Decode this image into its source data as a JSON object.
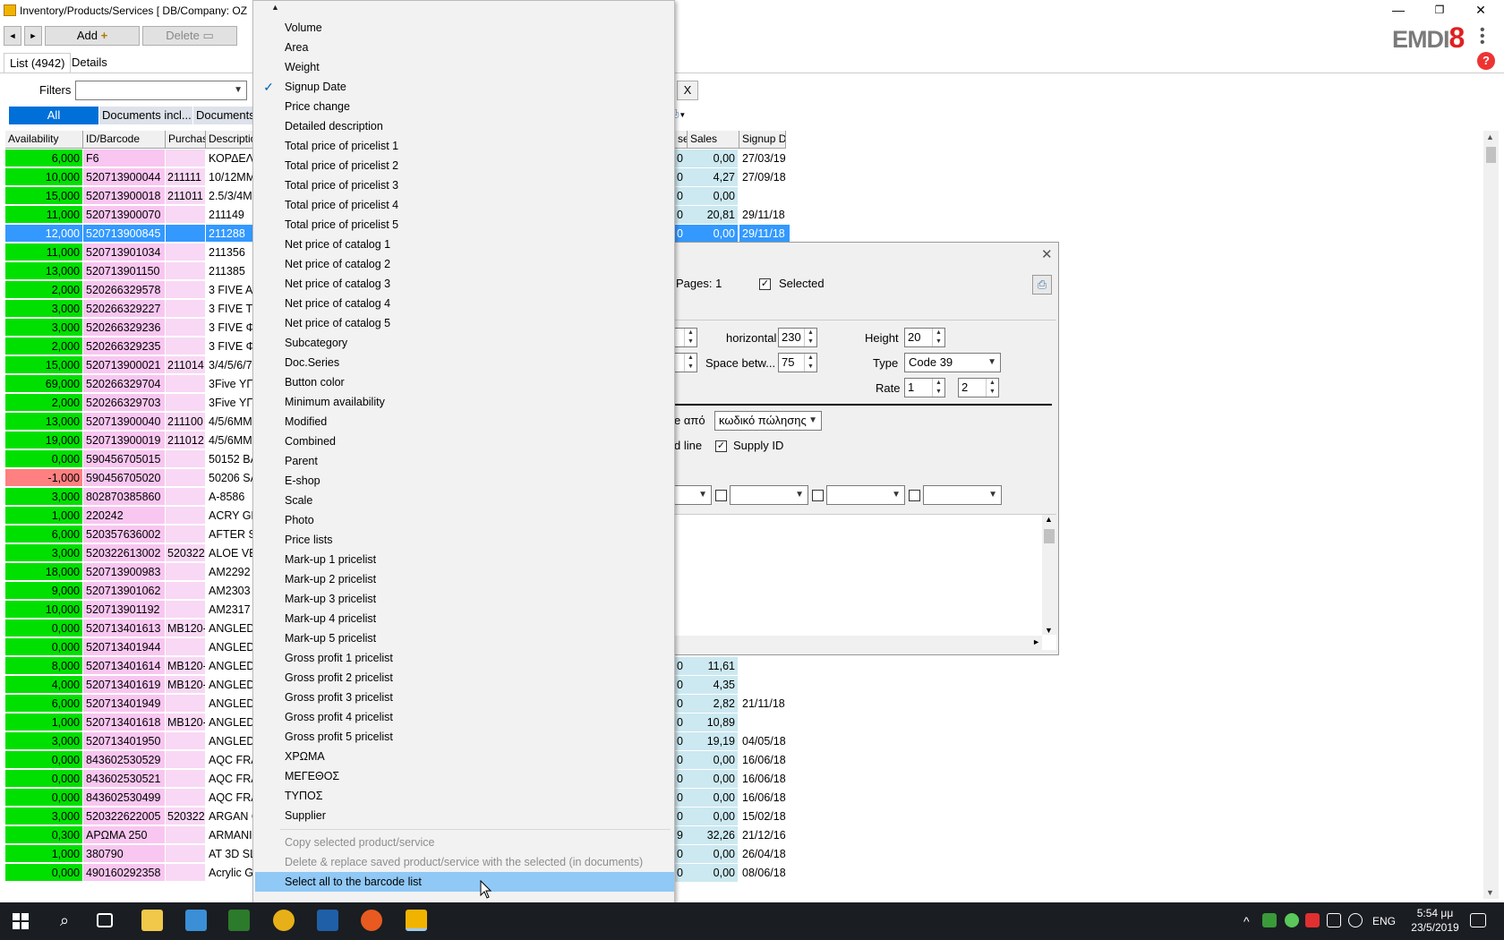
{
  "window": {
    "title": "Inventory/Products/Services  [ DB/Company: OZ",
    "minimize": "—",
    "restore": "❐",
    "close": "✕"
  },
  "toolbar": {
    "back": "◄",
    "forward": "►",
    "add_label": "Add",
    "delete_label": "Delete"
  },
  "tabs": {
    "list": "List (4942)",
    "details": "Details"
  },
  "filters": {
    "label": "Filters",
    "clear": "X"
  },
  "filter_tabs": {
    "all": "All",
    "docs1": "Documents incl...",
    "docs2": "Documents"
  },
  "logo": {
    "text": "EMDI",
    "num": "8",
    "help": "?"
  },
  "grid": {
    "headers": [
      "Availability",
      "ID/Barcode",
      "Purchas",
      "Description"
    ],
    "right_headers": [
      "se",
      "Sales",
      "Signup D"
    ],
    "rows": [
      {
        "av": "6,000",
        "id": "F6",
        "pu": "",
        "de": "ΚΟΡΔΕΛ"
      },
      {
        "av": "10,000",
        "id": "520713900044",
        "pu": "211111",
        "de": "10/12MM"
      },
      {
        "av": "15,000",
        "id": "520713900018",
        "pu": "211011",
        "de": "2.5/3/4MI"
      },
      {
        "av": "11,000",
        "id": "520713900070",
        "pu": "",
        "de": "211149"
      },
      {
        "av": "12,000",
        "id": "520713900845",
        "pu": "",
        "de": "211288"
      },
      {
        "av": "11,000",
        "id": "520713901034",
        "pu": "",
        "de": "211356"
      },
      {
        "av": "13,000",
        "id": "520713901150",
        "pu": "",
        "de": "211385"
      },
      {
        "av": "2,000",
        "id": "520266329578",
        "pu": "",
        "de": "3 FIVE A"
      },
      {
        "av": "3,000",
        "id": "520266329227",
        "pu": "",
        "de": "3 FIVE T"
      },
      {
        "av": "3,000",
        "id": "520266329236",
        "pu": "",
        "de": "3 FIVE Φ"
      },
      {
        "av": "2,000",
        "id": "520266329235",
        "pu": "",
        "de": "3 FIVE Φ"
      },
      {
        "av": "15,000",
        "id": "520713900021",
        "pu": "211014",
        "de": "3/4/5/6/7"
      },
      {
        "av": "69,000",
        "id": "520266329704",
        "pu": "",
        "de": "3Five ΥΓ"
      },
      {
        "av": "2,000",
        "id": "520266329703",
        "pu": "",
        "de": "3Five ΥΓ"
      },
      {
        "av": "13,000",
        "id": "520713900040",
        "pu": "211100",
        "de": "4/5/6MM"
      },
      {
        "av": "19,000",
        "id": "520713900019",
        "pu": "211012",
        "de": "4/5/6MM"
      },
      {
        "av": "0,000",
        "id": "590456705015",
        "pu": "",
        "de": "50152 BA"
      },
      {
        "av": "-1,000",
        "id": "590456705020",
        "pu": "",
        "de": "50206 SA"
      },
      {
        "av": "3,000",
        "id": "802870385860",
        "pu": "",
        "de": "A-8586"
      },
      {
        "av": "1,000",
        "id": "220242",
        "pu": "",
        "de": "ACRY GE"
      },
      {
        "av": "6,000",
        "id": "520357636002",
        "pu": "",
        "de": "AFTER S"
      },
      {
        "av": "3,000",
        "id": "520322613002",
        "pu": "520322",
        "de": "ALOE VE"
      },
      {
        "av": "18,000",
        "id": "520713900983",
        "pu": "",
        "de": "AM2292"
      },
      {
        "av": "9,000",
        "id": "520713901062",
        "pu": "",
        "de": "AM2303"
      },
      {
        "av": "10,000",
        "id": "520713901192",
        "pu": "",
        "de": "AM2317"
      },
      {
        "av": "0,000",
        "id": "520713401613",
        "pu": "MB120-",
        "de": "ANGLED"
      },
      {
        "av": "0,000",
        "id": "520713401944",
        "pu": "",
        "de": "ANGLED"
      },
      {
        "av": "8,000",
        "id": "520713401614",
        "pu": "MB120-",
        "de": "ANGLED"
      },
      {
        "av": "4,000",
        "id": "520713401619",
        "pu": "MB120-",
        "de": "ANGLED"
      },
      {
        "av": "6,000",
        "id": "520713401949",
        "pu": "",
        "de": "ANGLED"
      },
      {
        "av": "1,000",
        "id": "520713401618",
        "pu": "MB120-",
        "de": "ANGLED"
      },
      {
        "av": "3,000",
        "id": "520713401950",
        "pu": "",
        "de": "ANGLED"
      },
      {
        "av": "0,000",
        "id": "843602530529",
        "pu": "",
        "de": "AQC FRA"
      },
      {
        "av": "0,000",
        "id": "843602530521",
        "pu": "",
        "de": "AQC FRA"
      },
      {
        "av": "0,000",
        "id": "843602530499",
        "pu": "",
        "de": "AQC FRA"
      },
      {
        "av": "3,000",
        "id": "520322622005",
        "pu": "520322",
        "de": "ARGAN C"
      },
      {
        "av": "0,300",
        "id": "ΑΡΩΜΑ 250",
        "pu": "",
        "de": "ARMANI"
      },
      {
        "av": "1,000",
        "id": "380790",
        "pu": "",
        "de": "AT 3D SL"
      },
      {
        "av": "0,000",
        "id": "490160292358",
        "pu": "",
        "de": "Acrylic G"
      }
    ],
    "right_rows_top": [
      {
        "b": "0",
        "s": "0,00",
        "d": "27/03/19"
      },
      {
        "b": "0",
        "s": "4,27",
        "d": "27/09/18"
      },
      {
        "b": "0",
        "s": "0,00",
        "d": ""
      },
      {
        "b": "0",
        "s": "20,81",
        "d": "29/11/18"
      },
      {
        "b": "0",
        "s": "0,00",
        "d": "29/11/18"
      }
    ],
    "right_rows_bottom": [
      {
        "b": "0",
        "s": "11,61",
        "d": ""
      },
      {
        "b": "0",
        "s": "4,35",
        "d": ""
      },
      {
        "b": "0",
        "s": "2,82",
        "d": "21/11/18"
      },
      {
        "b": "0",
        "s": "10,89",
        "d": ""
      },
      {
        "b": "0",
        "s": "19,19",
        "d": "04/05/18"
      },
      {
        "b": "0",
        "s": "0,00",
        "d": "16/06/18"
      },
      {
        "b": "0",
        "s": "0,00",
        "d": "16/06/18"
      },
      {
        "b": "0",
        "s": "0,00",
        "d": "16/06/18"
      },
      {
        "b": "0",
        "s": "0,00",
        "d": "15/02/18"
      },
      {
        "b": "9",
        "s": "32,26",
        "d": "21/12/16"
      },
      {
        "b": "0",
        "s": "0,00",
        "d": "26/04/18"
      },
      {
        "b": "0",
        "s": "0,00",
        "d": "08/06/18"
      }
    ]
  },
  "dialog": {
    "close": "✕",
    "pages": "Pages: 1",
    "selected_label": "Selected",
    "horizontal_label": "horizontal",
    "horizontal_value": "230",
    "space_label": "Space betw...",
    "space_value": "75",
    "height_label": "Height",
    "height_value": "20",
    "type_label": "Type",
    "type_value": "Code 39",
    "rate_label": "Rate",
    "rate_value1": "1",
    "rate_value2": "2",
    "from_label": "e από",
    "from_value": "κωδικό πώλησης",
    "line_label": "d line",
    "supply_label": "Supply ID"
  },
  "menu": {
    "scroll_up": "▲",
    "scroll_down": "▼",
    "items": [
      {
        "label": "Volume",
        "checked": false
      },
      {
        "label": "Area",
        "checked": false
      },
      {
        "label": "Weight",
        "checked": false
      },
      {
        "label": "Signup Date",
        "checked": true
      },
      {
        "label": "Price change",
        "checked": false
      },
      {
        "label": "Detailed description",
        "checked": false
      },
      {
        "label": "Total price of pricelist 1",
        "checked": false
      },
      {
        "label": "Total price of pricelist 2",
        "checked": false
      },
      {
        "label": "Total price of pricelist 3",
        "checked": false
      },
      {
        "label": "Total price of pricelist 4",
        "checked": false
      },
      {
        "label": "Total price of pricelist 5",
        "checked": false
      },
      {
        "label": "Net price of catalog 1",
        "checked": false
      },
      {
        "label": "Net price of catalog 2",
        "checked": false
      },
      {
        "label": "Net price of catalog 3",
        "checked": false
      },
      {
        "label": "Net price of catalog 4",
        "checked": false
      },
      {
        "label": "Net price of catalog 5",
        "checked": false
      },
      {
        "label": "Subcategory",
        "checked": false
      },
      {
        "label": "Doc.Series",
        "checked": false
      },
      {
        "label": "Button color",
        "checked": false
      },
      {
        "label": "Minimum availability",
        "checked": false
      },
      {
        "label": "Modified",
        "checked": false
      },
      {
        "label": "Combined",
        "checked": false
      },
      {
        "label": "Parent",
        "checked": false
      },
      {
        "label": "E-shop",
        "checked": false
      },
      {
        "label": "Scale",
        "checked": false
      },
      {
        "label": "Photo",
        "checked": false
      },
      {
        "label": "Price lists",
        "checked": false
      },
      {
        "label": "Mark-up 1 pricelist",
        "checked": false
      },
      {
        "label": "Mark-up 2 pricelist",
        "checked": false
      },
      {
        "label": "Mark-up 3 pricelist",
        "checked": false
      },
      {
        "label": "Mark-up 4 pricelist",
        "checked": false
      },
      {
        "label": "Mark-up 5 pricelist",
        "checked": false
      },
      {
        "label": "Gross profit 1 pricelist",
        "checked": false
      },
      {
        "label": "Gross profit 2 pricelist",
        "checked": false
      },
      {
        "label": "Gross profit 3 pricelist",
        "checked": false
      },
      {
        "label": "Gross profit 4 pricelist",
        "checked": false
      },
      {
        "label": "Gross profit 5 pricelist",
        "checked": false
      },
      {
        "label": "ΧΡΩΜΑ",
        "checked": false
      },
      {
        "label": "ΜΕΓΕΘΟΣ",
        "checked": false
      },
      {
        "label": "ΤΥΠΟΣ",
        "checked": false
      },
      {
        "label": "Supplier",
        "checked": false
      }
    ],
    "actions": [
      {
        "label": "Copy selected product/service",
        "disabled": true
      },
      {
        "label": "Delete & replace saved product/service with the selected (in documents)",
        "disabled": true
      },
      {
        "label": "Select all to the barcode list",
        "disabled": false,
        "highlighted": true
      }
    ]
  },
  "taskbar": {
    "language": "ENG",
    "time": "5:54 μμ",
    "date": "23/5/2019",
    "tray_up": "^"
  }
}
